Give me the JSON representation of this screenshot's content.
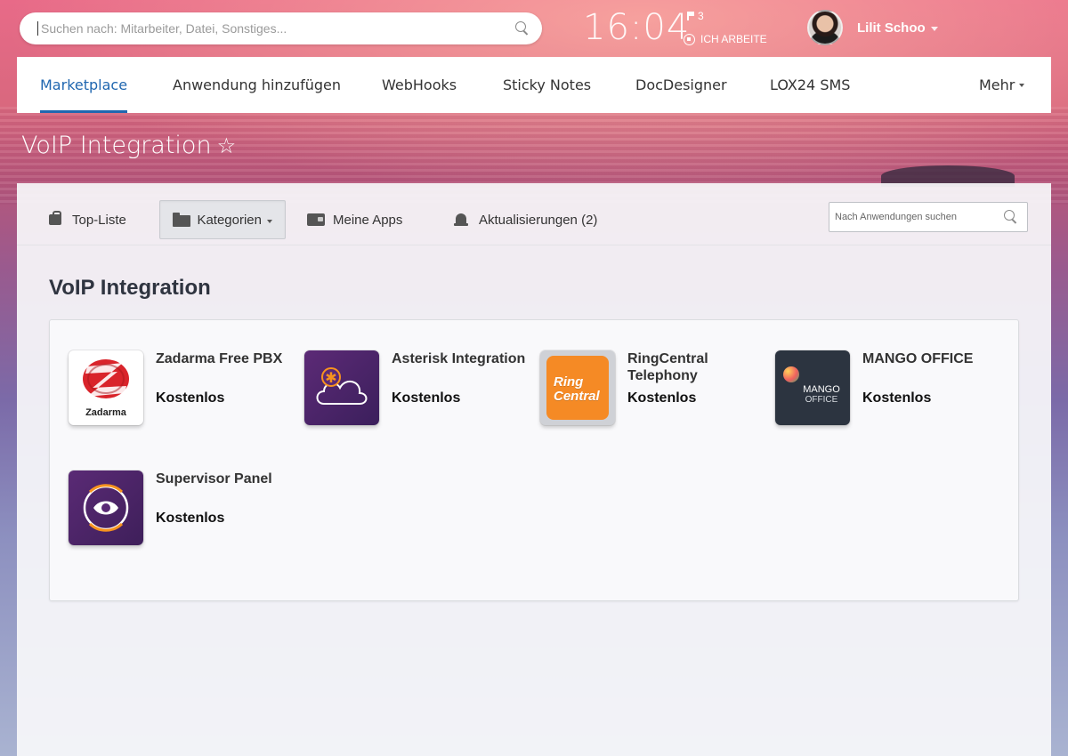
{
  "topbar": {
    "search_placeholder": "Suchen nach: Mitarbeiter, Datei, Sonstiges...",
    "clock": "16:04",
    "flag_count": "3",
    "work_status": "ICH ARBEITE",
    "user_name": "Lilit Schoo"
  },
  "nav": {
    "items": [
      {
        "label": "Marketplace",
        "active": true
      },
      {
        "label": "Anwendung hinzufügen"
      },
      {
        "label": "WebHooks"
      },
      {
        "label": "Sticky Notes"
      },
      {
        "label": "DocDesigner"
      },
      {
        "label": "LOX24 SMS"
      }
    ],
    "more_label": "Mehr"
  },
  "page": {
    "title": "VoIP Integration",
    "star": "☆"
  },
  "tabs": {
    "top_list": "Top-Liste",
    "categories": "Kategorien",
    "my_apps": "Meine Apps",
    "updates": "Aktualisierungen (2)",
    "search_placeholder": "Nach Anwendungen suchen"
  },
  "section": {
    "title": "VoIP Integration"
  },
  "apps": [
    {
      "name": "Zadarma Free PBX",
      "price": "Kostenlos",
      "icon": "zadarma-logo",
      "icon_text": "Zadarma"
    },
    {
      "name": "Asterisk Integration",
      "price": "Kostenlos",
      "icon": "asterisk-cloud-logo"
    },
    {
      "name": "RingCentral Telephony",
      "price": "Kostenlos",
      "icon": "ringcentral-logo",
      "icon_text_1": "Ring",
      "icon_text_2": "Central"
    },
    {
      "name": "MANGO OFFICE",
      "price": "Kostenlos",
      "icon": "mango-office-logo",
      "icon_text_1": "MANGO",
      "icon_text_2": "OFFICE"
    },
    {
      "name": "Supervisor Panel",
      "price": "Kostenlos",
      "icon": "supervisor-eye-logo"
    }
  ],
  "colors": {
    "accent": "#2067b0",
    "zadarma_red": "#d9242b",
    "ringcentral_orange": "#f58a25",
    "mango_dark": "#2c3440",
    "purple": "#5a2a75"
  }
}
